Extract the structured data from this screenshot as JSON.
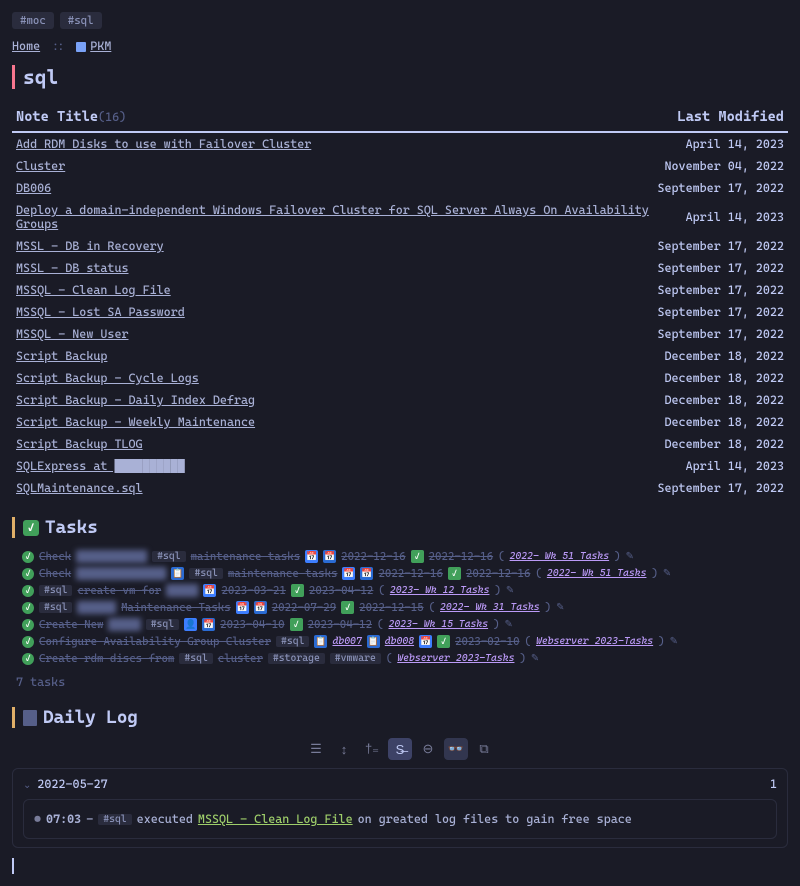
{
  "tags": [
    "#moc",
    "#sql"
  ],
  "breadcrumb": {
    "home": "Home",
    "sep": "::",
    "pkm": "PKM"
  },
  "title": "sql",
  "table": {
    "col_title": "Note Title",
    "count": "(16)",
    "col_modified": "Last Modified",
    "rows": [
      {
        "title": "Add RDM Disks to use with Failover Cluster",
        "date": "April 14, 2023"
      },
      {
        "title": "Cluster",
        "date": "November 04, 2022"
      },
      {
        "title": "DB006",
        "date": "September 17, 2022"
      },
      {
        "title": "Deploy a domain-independent Windows Failover Cluster for SQL Server Always On Availability Groups",
        "date": "April 14, 2023"
      },
      {
        "title": "MSSL - DB in Recovery",
        "date": "September 17, 2022"
      },
      {
        "title": "MSSL - DB status",
        "date": "September 17, 2022"
      },
      {
        "title": "MSSQL - Clean Log File",
        "date": "September 17, 2022"
      },
      {
        "title": "MSSQL - Lost SA Password",
        "date": "September 17, 2022"
      },
      {
        "title": "MSSQL - New User",
        "date": "September 17, 2022"
      },
      {
        "title": "Script Backup",
        "date": "December 18, 2022"
      },
      {
        "title": "Script Backup - Cycle Logs",
        "date": "December 18, 2022"
      },
      {
        "title": "Script Backup - Daily Index Defrag",
        "date": "December 18, 2022"
      },
      {
        "title": "Script Backup - Weekly Maintenance",
        "date": "December 18, 2022"
      },
      {
        "title": "Script Backup TLOG",
        "date": "December 18, 2022"
      },
      {
        "title": "SQLExpress at ██████████",
        "date": "April 14, 2023"
      },
      {
        "title": "SQLMaintenance.sql",
        "date": "September 17, 2022"
      }
    ]
  },
  "tasks_heading": "Tasks",
  "tasks": [
    {
      "text1": "Check",
      "blur1": "███████████",
      "tag1": "#sql",
      "text2": "maintenance tasks",
      "date1": "2022-12-16",
      "date2": "2022-12-16",
      "link": "2022- Wk 51 Tasks"
    },
    {
      "text1": "Check",
      "blur1": "██████████████",
      "tag1": "#sql",
      "text2": "maintenance tasks",
      "date1": "2022-12-16",
      "date2": "2022-12-16",
      "link": "2022- Wk 51 Tasks"
    },
    {
      "tag1": "#sql",
      "text1": "create vm for",
      "blur1": "█████",
      "date1": "2023-03-21",
      "date2": "2023-04-12",
      "link": "2023- Wk 12 Tasks"
    },
    {
      "tag1": "#sql",
      "blur1": "██████",
      "text1": "Maintenance Tasks",
      "date1": "2022-07-29",
      "date2": "2022-12-15",
      "link": "2022- Wk 31 Tasks"
    },
    {
      "text1": "Create New",
      "blur1": "█████",
      "tag1": "#sql",
      "date1": "2023-04-10",
      "date2": "2023-04-12",
      "link": "2023- Wk 15 Tasks"
    },
    {
      "text1": "Configure Availability Group Cluster",
      "tag1": "#sql",
      "link1": "db007",
      "link2": "db008",
      "date1": "2023-02-10",
      "link": "Webserver 2023-Tasks"
    },
    {
      "text1": "Create rdm discs from",
      "tag1": "#sql",
      "text2": "cluster",
      "tag2": "#storage",
      "tag3": "#vmware",
      "link": "Webserver 2023-Tasks"
    }
  ],
  "tasks_count": "7 tasks",
  "daily_log_heading": "Daily Log",
  "log": {
    "date": "2022-05-27",
    "count": "1",
    "time": "07:03",
    "dash": "-",
    "tag": "#sql",
    "text1": "executed",
    "link": "MSSQL - Clean Log File",
    "text2": "on greated log files to gain free space"
  }
}
